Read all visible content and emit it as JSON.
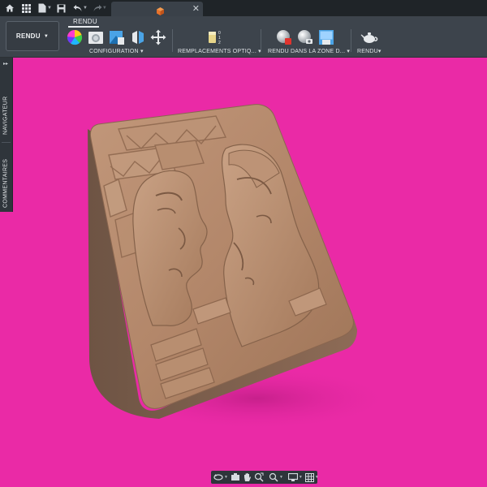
{
  "toolbar": {
    "home_icon": "home-icon",
    "apps_icon": "grid-icon",
    "file_icon": "file-icon",
    "save_icon": "save-icon",
    "undo_icon": "undo-icon",
    "redo_icon": "redo-icon"
  },
  "document_tab": {
    "icon": "cube-icon",
    "close_label": "✕"
  },
  "ribbon": {
    "active_tab": "RENDU",
    "workspace_label": "RENDU",
    "groups": [
      {
        "label": "CONFIGURATION",
        "tools": [
          "color-wheel-icon",
          "scene-settings-icon",
          "texture-map-icon",
          "appearance-icon",
          "move-icon"
        ]
      },
      {
        "label": "REMPLACEMENTS OPTIQ...",
        "tools": [
          "stacked-layers-icon"
        ]
      },
      {
        "label": "RENDU DANS LA ZONE D...",
        "tools": [
          "sphere-render-icon",
          "sphere-capture-icon",
          "image-render-icon"
        ]
      },
      {
        "label": "RENDU",
        "tools": [
          "teapot-icon"
        ]
      }
    ]
  },
  "sidepanel": {
    "navigator_label": "NAVIGATEUR",
    "comments_label": "COMMENTAIRES"
  },
  "colors": {
    "background": "#ea2aa6",
    "accent_orange": "#e8722b",
    "ribbon": "#3d444c",
    "model": "#b08160"
  },
  "navbar": {
    "tools": [
      "orbit-icon",
      "look-at-icon",
      "pan-icon",
      "zoom-icon",
      "fit-icon",
      "display-settings-icon",
      "grid-settings-icon"
    ]
  }
}
